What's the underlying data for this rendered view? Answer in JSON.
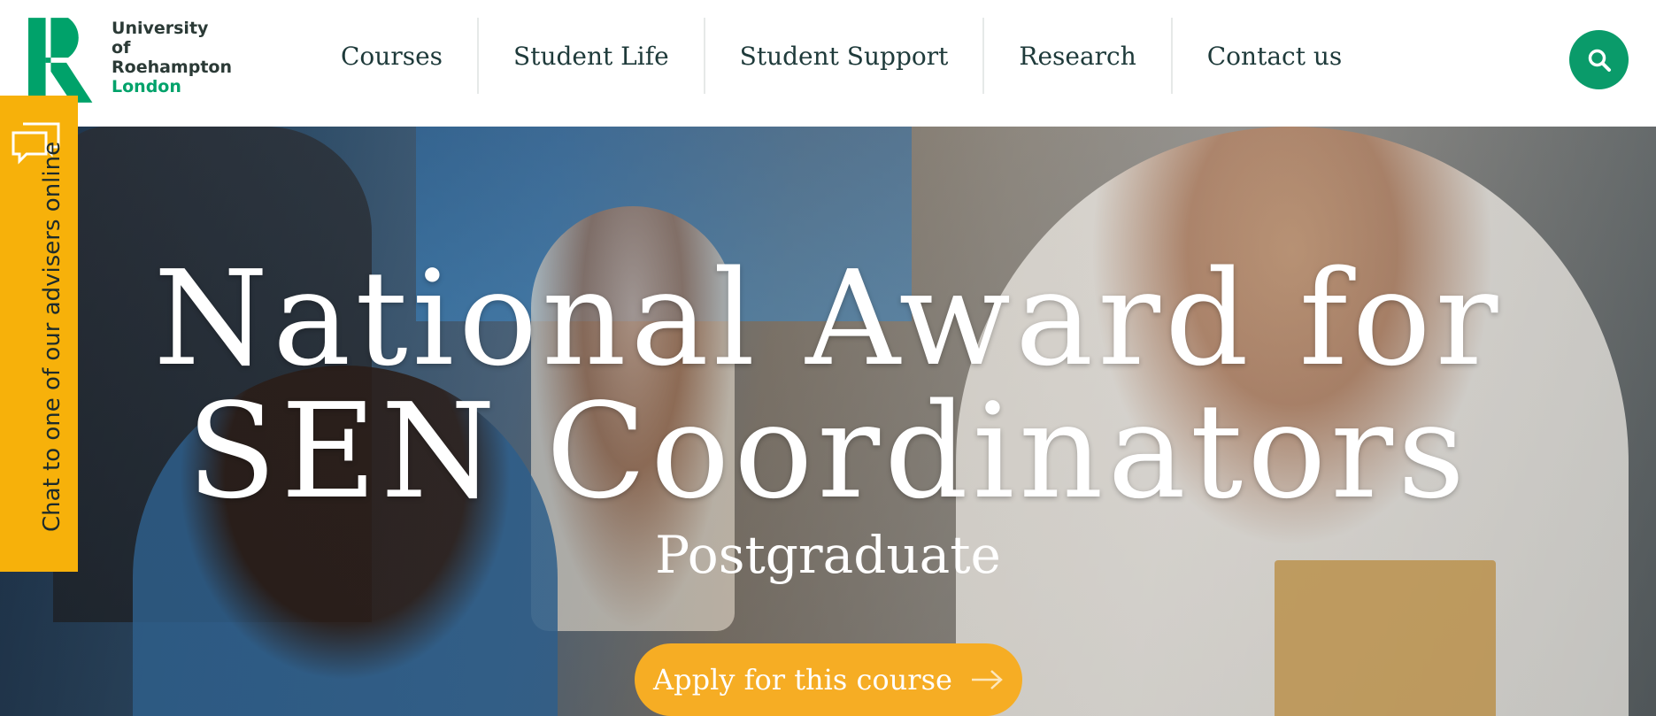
{
  "header": {
    "logo": {
      "line1": "University of",
      "line2": "Roehampton",
      "line3": "London",
      "mark_color": "#00a26a"
    },
    "nav": [
      {
        "label": "Courses"
      },
      {
        "label": "Student Life"
      },
      {
        "label": "Student Support"
      },
      {
        "label": "Research"
      },
      {
        "label": "Contact us"
      }
    ],
    "search": {
      "icon": "search-icon",
      "color": "#0a9b6a"
    }
  },
  "chat": {
    "label": "Chat to one of our advisers online",
    "icon": "chat-bubbles-icon",
    "color": "#f7b10a"
  },
  "hero": {
    "title_line1": "National Award for",
    "title_line2": "SEN Coordinators",
    "subtitle": "Postgraduate",
    "cta_label": "Apply for this course",
    "cta_icon": "arrow-right-icon",
    "cta_color": "#f6ad24"
  }
}
